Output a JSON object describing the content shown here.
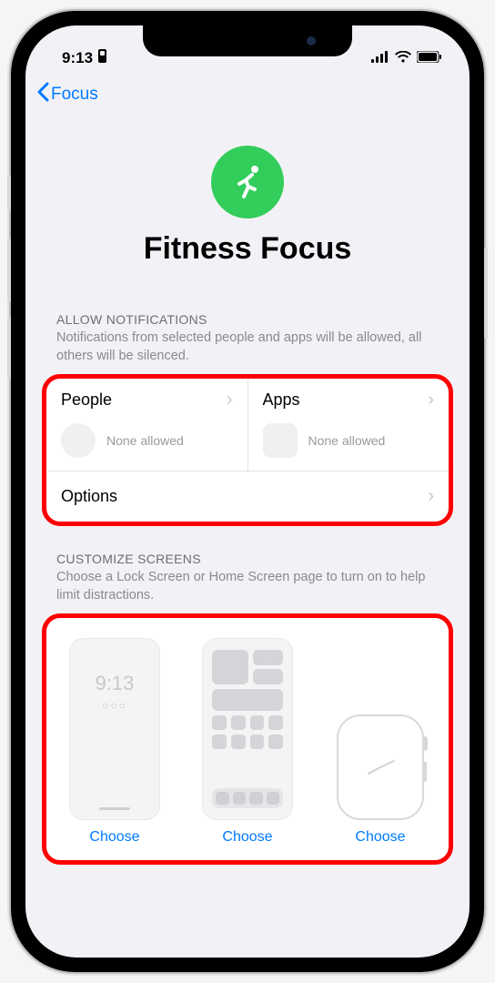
{
  "status": {
    "time": "9:13"
  },
  "nav": {
    "back_label": "Focus"
  },
  "header": {
    "title": "Fitness Focus",
    "icon": "running-icon",
    "icon_bg": "#32cd5a"
  },
  "sections": {
    "allow_notifications": {
      "label": "ALLOW NOTIFICATIONS",
      "description": "Notifications from selected people and apps will be allowed, all others will be silenced.",
      "people": {
        "title": "People",
        "status": "None allowed"
      },
      "apps": {
        "title": "Apps",
        "status": "None allowed"
      },
      "options": {
        "title": "Options"
      }
    },
    "customize_screens": {
      "label": "CUSTOMIZE SCREENS",
      "description": "Choose a Lock Screen or Home Screen page to turn on to help limit distractions.",
      "items": [
        {
          "type": "lock",
          "time": "9:13",
          "action": "Choose"
        },
        {
          "type": "home",
          "action": "Choose"
        },
        {
          "type": "watch",
          "action": "Choose"
        }
      ]
    }
  }
}
